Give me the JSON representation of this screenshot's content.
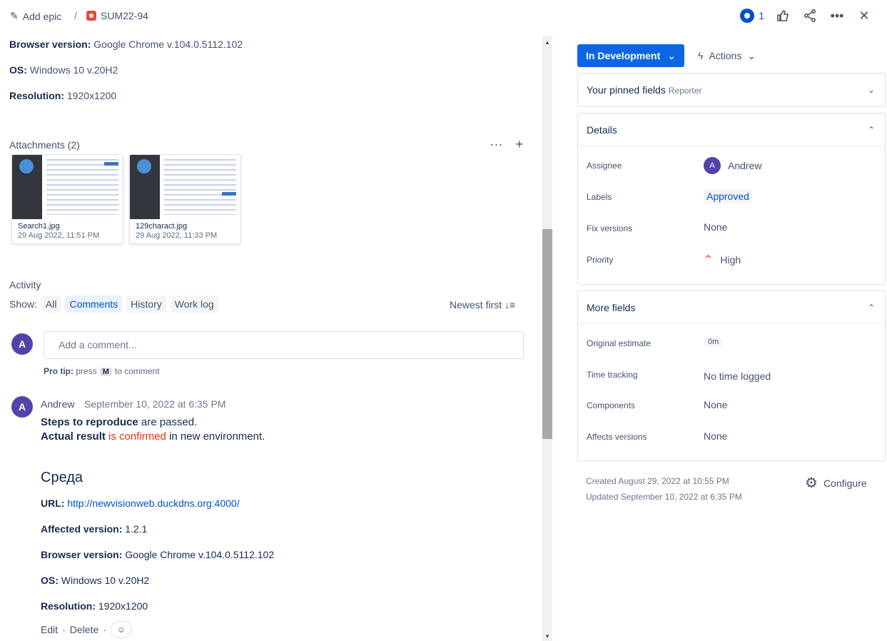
{
  "header": {
    "add_epic": "Add epic",
    "separator": "/",
    "issue_key": "SUM22-94",
    "watch_count": "1"
  },
  "env_top": {
    "browser_label": "Browser version:",
    "browser_value": "Google Chrome v.104.0.5112.102",
    "os_label": "OS:",
    "os_value": "Windows 10 v.20H2",
    "res_label": "Resolution:",
    "res_value": "1920x1200"
  },
  "attachments": {
    "title": "Attachments (2)",
    "items": [
      {
        "name": "Search1.jpg",
        "date": "29 Aug 2022, 11:51 PM"
      },
      {
        "name": "129charact.jpg",
        "date": "29 Aug 2022, 11:33 PM"
      }
    ]
  },
  "activity": {
    "title": "Activity",
    "show_label": "Show:",
    "filters": [
      "All",
      "Comments",
      "History",
      "Work log"
    ],
    "sort": "Newest first",
    "avatar_letter": "A",
    "comment_placeholder": "Add a comment...",
    "protip_prefix": "Pro tip:",
    "protip_press": "press",
    "protip_key": "M",
    "protip_suffix": "to comment"
  },
  "comment": {
    "author": "Andrew",
    "date": "September 10, 2022 at 6:35 PM",
    "line1_bold": "Steps to reproduce",
    "line1_rest": " are passed.",
    "line2_bold": "Actual result",
    "line2_red": " is confirmed",
    "line2_rest": " in new environment.",
    "heading": "Среда",
    "url_label": "URL:",
    "url_value": "http://newvisionweb.duckdns.org:4000/",
    "affected_label": "Affected version:",
    "affected_value": "1.2.1",
    "browser_label": "Browser version:",
    "browser_value": "Google Chrome v.104.0.5112.102",
    "os_label": "OS:",
    "os_value": "Windows 10 v.20H2",
    "res_label": "Resolution:",
    "res_value": "1920x1200",
    "edit": "Edit",
    "delete": "Delete",
    "dot": "·"
  },
  "sidebar": {
    "status": "In Development",
    "actions": "Actions",
    "pinned_title": "Your pinned fields",
    "pinned_sub": "Reporter",
    "details_title": "Details",
    "assignee_label": "Assignee",
    "assignee_value": "Andrew",
    "assignee_initial": "A",
    "labels_label": "Labels",
    "labels_value": "Approved",
    "fix_label": "Fix versions",
    "fix_value": "None",
    "priority_label": "Priority",
    "priority_value": "High",
    "more_title": "More fields",
    "orig_label": "Original estimate",
    "orig_value": "0m",
    "time_label": "Time tracking",
    "time_value": "No time logged",
    "comp_label": "Components",
    "comp_value": "None",
    "affects_label": "Affects versions",
    "affects_value": "None",
    "created": "Created August 29, 2022 at 10:55 PM",
    "updated": "Updated September 10, 2022 at 6:35 PM",
    "configure": "Configure"
  }
}
